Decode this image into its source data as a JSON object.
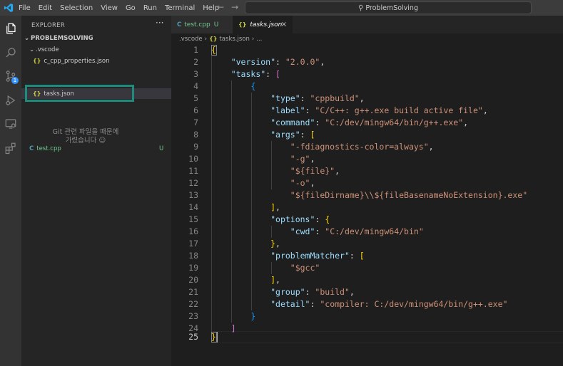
{
  "menu": [
    "File",
    "Edit",
    "Selection",
    "View",
    "Go",
    "Run",
    "Terminal",
    "Help"
  ],
  "command_center": {
    "search_text": "ProblemSolving"
  },
  "activity_bar": {
    "icons": [
      "explorer-icon",
      "search-icon",
      "source-control-icon",
      "run-debug-icon",
      "remote-explorer-icon",
      "extensions-icon"
    ],
    "source_control_badge": "1"
  },
  "sidebar": {
    "title": "EXPLORER",
    "more_actions": "···",
    "root_folder": "PROBLEMSOLVING",
    "folder_vscode": ".vscode",
    "file_c_cpp": "c_cpp_properties.json",
    "file_tasks": "tasks.json",
    "git_message_line1": "Git 관련 파일을 때문에",
    "git_message_line2": "가렸습니다 ☺",
    "file_test": "test.cpp",
    "file_test_status": "U"
  },
  "tabs": [
    {
      "label": "test.cpp",
      "status": "U"
    },
    {
      "label": "tasks.json",
      "close": "×"
    }
  ],
  "breadcrumb": {
    "folder": ".vscode",
    "file": "tasks.json",
    "tail": "..."
  },
  "editor": {
    "line_numbers": [
      "1",
      "2",
      "3",
      "4",
      "5",
      "6",
      "7",
      "8",
      "9",
      "10",
      "11",
      "12",
      "13",
      "14",
      "15",
      "16",
      "17",
      "18",
      "19",
      "20",
      "21",
      "22",
      "23",
      "24",
      "25"
    ],
    "active_line": "25",
    "tokens": {
      "version_key": "\"version\"",
      "version_val": "\"2.0.0\"",
      "tasks_key": "\"tasks\"",
      "type_key": "\"type\"",
      "type_val": "\"cppbuild\"",
      "label_key": "\"label\"",
      "label_val": "\"C/C++: g++.exe build active file\"",
      "command_key": "\"command\"",
      "command_val": "\"C:/dev/mingw64/bin/g++.exe\"",
      "args_key": "\"args\"",
      "arg1": "\"-fdiagnostics-color=always\"",
      "arg2": "\"-g\"",
      "arg3": "\"${file}\"",
      "arg4": "\"-o\"",
      "arg5": "\"${fileDirname}\\\\${fileBasenameNoExtension}.exe\"",
      "options_key": "\"options\"",
      "cwd_key": "\"cwd\"",
      "cwd_val": "\"C:/dev/mingw64/bin\"",
      "matcher_key": "\"problemMatcher\"",
      "matcher_val": "\"$gcc\"",
      "group_key": "\"group\"",
      "group_val": "\"build\"",
      "detail_key": "\"detail\"",
      "detail_val": "\"compiler: C:/dev/mingw64/bin/g++.exe\""
    }
  },
  "colors": {
    "background": "#1e1e1e",
    "sidebar": "#252526",
    "activity_bar": "#333333",
    "title_bar": "#3c3c3c",
    "json_key": "#9cdcfe",
    "json_string": "#ce9178",
    "bracket_yellow": "#ffd700",
    "bracket_purple": "#da70d6",
    "bracket_blue": "#179fff",
    "untracked_green": "#73c991",
    "highlight_box": "#1d8c7c"
  }
}
